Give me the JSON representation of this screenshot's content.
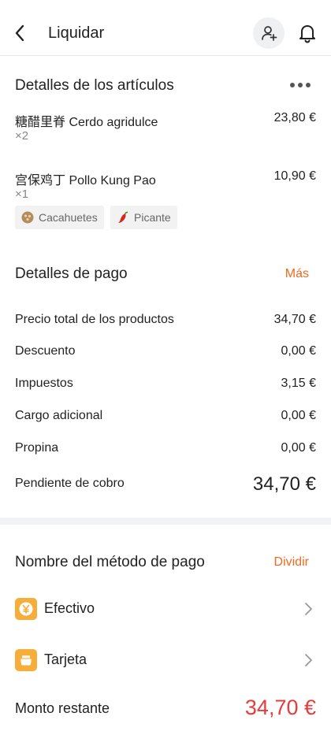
{
  "header": {
    "title": "Liquidar",
    "icons": {
      "back": "chevron-left-icon",
      "add_person": "person-add-icon",
      "notifications": "bell-icon"
    }
  },
  "items_section": {
    "title": "Detalles de los artículos",
    "items": [
      {
        "name": "糖醋里脊 Cerdo agridulce",
        "qty": "×2",
        "price": "23,80 €"
      },
      {
        "name": "宫保鸡丁 Pollo Kung Pao",
        "qty": "×1",
        "price": "10,90 €",
        "tags": [
          {
            "label": "Cacahuetes",
            "icon": "peanut-icon"
          },
          {
            "label": "Picante",
            "icon": "chili-pepper-icon"
          }
        ]
      }
    ]
  },
  "payment_details": {
    "title": "Detalles de pago",
    "more_label": "Más",
    "rows": [
      {
        "label": "Precio total de los productos",
        "value": "34,70 €"
      },
      {
        "label": "Descuento",
        "value": "0,00 €"
      },
      {
        "label": "Impuestos",
        "value": "3,15 €"
      },
      {
        "label": "Cargo adicional",
        "value": "0,00 €"
      },
      {
        "label": "Propina",
        "value": "0,00 €"
      }
    ],
    "pending": {
      "label": "Pendiente de cobro",
      "value": "34,70 €"
    }
  },
  "payment_method": {
    "title": "Nombre del método de pago",
    "split_label": "Dividir",
    "methods": [
      {
        "label": "Efectivo",
        "icon": "yen-coin-icon"
      },
      {
        "label": "Tarjeta",
        "icon": "card-wallet-icon"
      }
    ],
    "remaining": {
      "label": "Monto restante",
      "value": "34,70 €"
    }
  },
  "colors": {
    "accent": "#ee6a1f",
    "remaining": "#e83b3b",
    "method_icon": "#f6ad3a"
  }
}
